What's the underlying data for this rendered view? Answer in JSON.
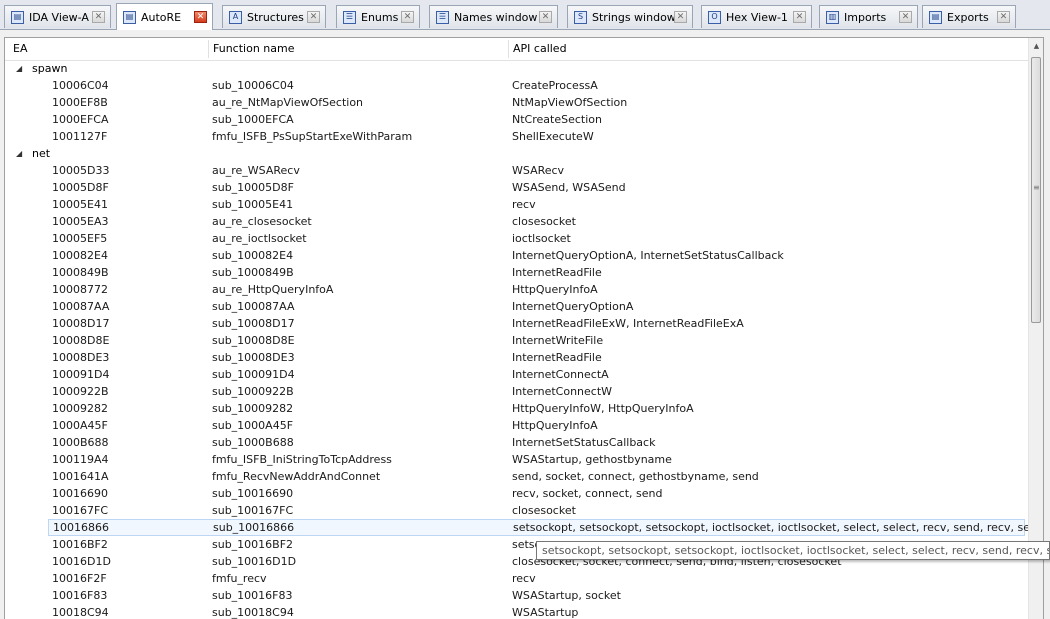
{
  "tabs": [
    {
      "label": "IDA View-A",
      "icon": "ida-view-icon"
    },
    {
      "label": "AutoRE",
      "icon": "autore-icon",
      "active": true
    },
    {
      "label": "Structures",
      "icon": "structures-icon"
    },
    {
      "label": "Enums",
      "icon": "enums-icon"
    },
    {
      "label": "Names window",
      "icon": "names-icon"
    },
    {
      "label": "Strings window",
      "icon": "strings-icon"
    },
    {
      "label": "Hex View-1",
      "icon": "hex-view-icon"
    },
    {
      "label": "Imports",
      "icon": "imports-icon"
    },
    {
      "label": "Exports",
      "icon": "exports-icon"
    }
  ],
  "table": {
    "columns": [
      "EA",
      "Function name",
      "API called"
    ],
    "groups": [
      {
        "name": "spawn",
        "rows": [
          {
            "ea": "10006C04",
            "fn": "sub_10006C04",
            "api": "CreateProcessA"
          },
          {
            "ea": "1000EF8B",
            "fn": "au_re_NtMapViewOfSection",
            "api": "NtMapViewOfSection"
          },
          {
            "ea": "1000EFCA",
            "fn": "sub_1000EFCA",
            "api": "NtCreateSection"
          },
          {
            "ea": "1001127F",
            "fn": "fmfu_ISFB_PsSupStartExeWithParam",
            "api": "ShellExecuteW"
          }
        ]
      },
      {
        "name": "net",
        "rows": [
          {
            "ea": "10005D33",
            "fn": "au_re_WSARecv",
            "api": "WSARecv"
          },
          {
            "ea": "10005D8F",
            "fn": "sub_10005D8F",
            "api": "WSASend, WSASend"
          },
          {
            "ea": "10005E41",
            "fn": "sub_10005E41",
            "api": "recv"
          },
          {
            "ea": "10005EA3",
            "fn": "au_re_closesocket",
            "api": "closesocket"
          },
          {
            "ea": "10005EF5",
            "fn": "au_re_ioctlsocket",
            "api": "ioctlsocket"
          },
          {
            "ea": "100082E4",
            "fn": "sub_100082E4",
            "api": "InternetQueryOptionA, InternetSetStatusCallback"
          },
          {
            "ea": "1000849B",
            "fn": "sub_1000849B",
            "api": "InternetReadFile"
          },
          {
            "ea": "10008772",
            "fn": "au_re_HttpQueryInfoA",
            "api": "HttpQueryInfoA"
          },
          {
            "ea": "100087AA",
            "fn": "sub_100087AA",
            "api": "InternetQueryOptionA"
          },
          {
            "ea": "10008D17",
            "fn": "sub_10008D17",
            "api": "InternetReadFileExW, InternetReadFileExA"
          },
          {
            "ea": "10008D8E",
            "fn": "sub_10008D8E",
            "api": "InternetWriteFile"
          },
          {
            "ea": "10008DE3",
            "fn": "sub_10008DE3",
            "api": "InternetReadFile"
          },
          {
            "ea": "100091D4",
            "fn": "sub_100091D4",
            "api": "InternetConnectA"
          },
          {
            "ea": "1000922B",
            "fn": "sub_1000922B",
            "api": "InternetConnectW"
          },
          {
            "ea": "10009282",
            "fn": "sub_10009282",
            "api": "HttpQueryInfoW, HttpQueryInfoA"
          },
          {
            "ea": "1000A45F",
            "fn": "sub_1000A45F",
            "api": "HttpQueryInfoA"
          },
          {
            "ea": "1000B688",
            "fn": "sub_1000B688",
            "api": "InternetSetStatusCallback"
          },
          {
            "ea": "100119A4",
            "fn": "fmfu_ISFB_IniStringToTcpAddress",
            "api": "WSAStartup, gethostbyname"
          },
          {
            "ea": "1001641A",
            "fn": "fmfu_RecvNewAddrAndConnet",
            "api": "send, socket, connect, gethostbyname, send"
          },
          {
            "ea": "10016690",
            "fn": "sub_10016690",
            "api": "recv, socket, connect, send"
          },
          {
            "ea": "100167FC",
            "fn": "sub_100167FC",
            "api": "closesocket"
          },
          {
            "ea": "10016866",
            "fn": "sub_10016866",
            "api": "setsockopt, setsockopt, setsockopt, ioctlsocket, ioctlsocket, select, select, recv, send, recv, send...",
            "selected": true
          },
          {
            "ea": "10016BF2",
            "fn": "sub_10016BF2",
            "api": "setso"
          },
          {
            "ea": "10016D1D",
            "fn": "sub_10016D1D",
            "api": "closesocket, socket, connect, send, bind, listen, closesocket"
          },
          {
            "ea": "10016F2F",
            "fn": "fmfu_recv",
            "api": "recv"
          },
          {
            "ea": "10016F83",
            "fn": "sub_10016F83",
            "api": "WSAStartup, socket"
          },
          {
            "ea": "10018C94",
            "fn": "sub_10018C94",
            "api": "WSAStartup"
          }
        ]
      }
    ]
  },
  "tooltip": {
    "text": "setsockopt, setsockopt, setsockopt, ioctlsocket, ioctlsocket, select, select, recv, send, recv, send, s"
  },
  "scrollbar": {
    "up_icon": "scroll-up-icon",
    "grip_icon": "scroll-grip-icon"
  }
}
